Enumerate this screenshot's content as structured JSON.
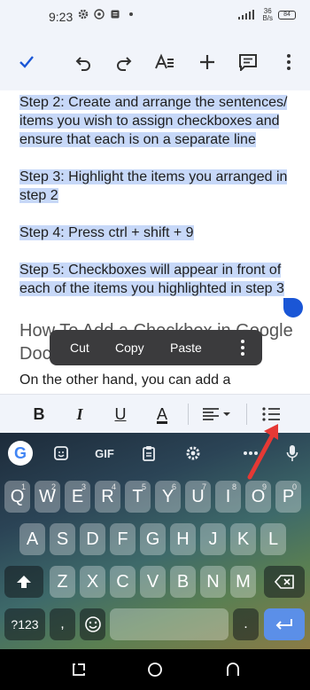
{
  "status_bar": {
    "time": "9:23",
    "data_rate_value": "36",
    "data_rate_unit": "B/s",
    "battery": "84"
  },
  "toolbar": {
    "icons": [
      "check-icon",
      "undo-icon",
      "redo-icon",
      "text-format-icon",
      "add-icon",
      "comment-icon",
      "more-vert-icon"
    ]
  },
  "document": {
    "paragraphs": [
      "Step 2: Create and arrange the sentences/ items you wish to assign checkboxes and ensure that each is on a separate line",
      "Step 3: Highlight the items you arranged in step 2",
      "Step 4: Press ctrl + shift + 9",
      "Step 5: Checkboxes will appear in front of each of the items you highlighted in step 3"
    ],
    "heading": "How To Add a Checkbox in Google Docs with a Shortcut",
    "body": "On the other hand, you can add a"
  },
  "context_menu": {
    "cut": "Cut",
    "copy": "Copy",
    "paste": "Paste"
  },
  "format_bar": {
    "bold": "B",
    "italic": "I",
    "underline": "U",
    "text_color": "A"
  },
  "keyboard": {
    "gif_label": "GIF",
    "row1": [
      {
        "key": "Q",
        "num": "1"
      },
      {
        "key": "W",
        "num": "2"
      },
      {
        "key": "E",
        "num": "3"
      },
      {
        "key": "R",
        "num": "4"
      },
      {
        "key": "T",
        "num": "5"
      },
      {
        "key": "Y",
        "num": "6"
      },
      {
        "key": "U",
        "num": "7"
      },
      {
        "key": "I",
        "num": "8"
      },
      {
        "key": "O",
        "num": "9"
      },
      {
        "key": "P",
        "num": "0"
      }
    ],
    "row2": [
      "A",
      "S",
      "D",
      "F",
      "G",
      "H",
      "J",
      "K",
      "L"
    ],
    "row3": [
      "Z",
      "X",
      "C",
      "V",
      "B",
      "N",
      "M"
    ],
    "sym_key": "?123",
    "comma_key": ","
  },
  "colors": {
    "selection": "#c7d8f8",
    "accent": "#1a56d6",
    "annotation_arrow": "#e53935"
  }
}
